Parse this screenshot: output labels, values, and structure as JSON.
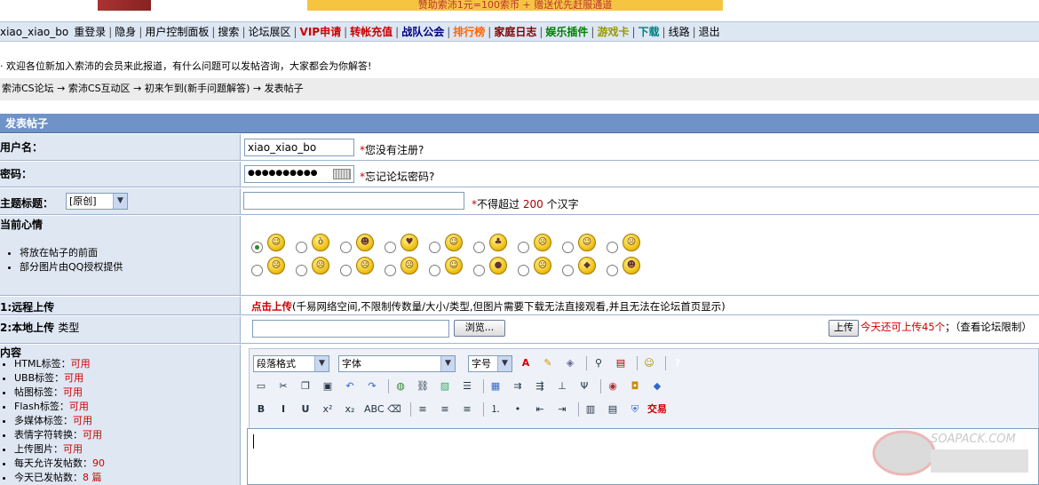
{
  "banner": {
    "ad_text": "赞助索沛1元=100索币 + 赠送优先赶服通道"
  },
  "nav": {
    "items": [
      {
        "label": "xiao_xiao_bo",
        "color": "#000"
      },
      {
        "label": "重登录",
        "color": "#000"
      },
      {
        "label": "隐身",
        "color": "#000"
      },
      {
        "label": "用户控制面板",
        "color": "#000"
      },
      {
        "label": "搜索",
        "color": "#000"
      },
      {
        "label": "论坛展区",
        "color": "#000"
      },
      {
        "label": "VIP申请",
        "color": "#cc0000"
      },
      {
        "label": "转帐充值",
        "color": "#cc0000"
      },
      {
        "label": "战队公会",
        "color": "#000080"
      },
      {
        "label": "排行榜",
        "color": "#ff6600"
      },
      {
        "label": "家庭日志",
        "color": "#800000"
      },
      {
        "label": "娱乐插件",
        "color": "#008000"
      },
      {
        "label": "游戏卡",
        "color": "#999900"
      },
      {
        "label": "下载",
        "color": "#008080"
      },
      {
        "label": "线路",
        "color": "#000"
      },
      {
        "label": "退出",
        "color": "#000"
      }
    ]
  },
  "welcome": "欢迎各位新加入索沛的会员来此报道，有什么问题可以发帖咨询，大家都会为你解答!",
  "breadcrumb": [
    "索沛CS论坛",
    "→ 索沛CS互动区",
    "→ 初来乍到(新手问题解答)",
    "→ 发表帖子"
  ],
  "form": {
    "title": "发表帖子",
    "username": {
      "label": "用户名：",
      "value": "xiao_xiao_bo",
      "hint": "您没有注册?"
    },
    "password": {
      "label": "密码：",
      "value": "●●●●●●●●●●",
      "hint": "忘记论坛密码?"
    },
    "subject": {
      "label": "主题标题：",
      "prefix_select": "[原创]",
      "value": "",
      "hint_pre": "不得超过",
      "hint_num": "200",
      "hint_post": "个汉字"
    },
    "mood": {
      "label": "当前心情",
      "notes": [
        "将放在帖子的前面",
        "部分图片由QQ授权提供"
      ],
      "selected_index": 0
    },
    "remote_upload": {
      "label": "1:远程上传",
      "link": "点击上传",
      "desc": "(千易网络空间,不限制传数量/大小/类型,但图片需要下载无法直接观看,并且无法在论坛首页显示)"
    },
    "local_upload": {
      "label": "2:本地上传",
      "type_label": "类型",
      "browse_label": "浏览...",
      "upload_label": "上传",
      "quota_text": "今天还可上传45个",
      "limit_text": "；（查看论坛限制）"
    },
    "content": {
      "label": "内容",
      "perms": [
        {
          "name": "HTML标签：",
          "value": "可用"
        },
        {
          "name": "UBB标签：",
          "value": "可用"
        },
        {
          "name": "帖图标签：",
          "value": "可用"
        },
        {
          "name": "Flash标签：",
          "value": "可用"
        },
        {
          "name": "多媒体标签：",
          "value": "可用"
        },
        {
          "name": "表情字符转换：",
          "value": "可用"
        },
        {
          "name": "上传图片：",
          "value": "可用"
        },
        {
          "name": "每天允许发帖数：",
          "value": "90"
        },
        {
          "name": "今天已发帖数：",
          "value": "8 篇"
        }
      ]
    }
  },
  "editor": {
    "paragraph_select": "段落格式",
    "font_select": "字体",
    "size_select": "字号",
    "trade_label": "交易"
  },
  "watermark": {
    "text": "SOAPACK.COM"
  }
}
